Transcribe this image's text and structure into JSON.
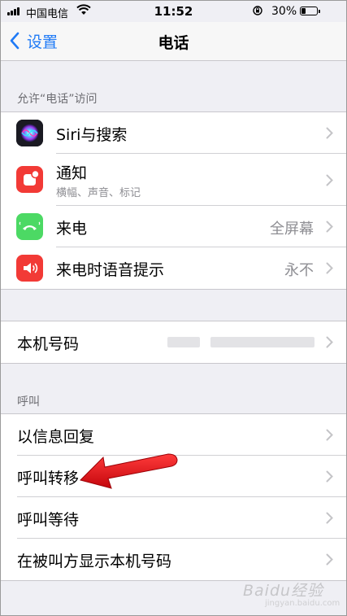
{
  "status_bar": {
    "carrier": "中国电信",
    "time": "11:52",
    "battery": "30%",
    "battery_level": 0.3
  },
  "nav": {
    "back_label": "设置",
    "title": "电话"
  },
  "section_allow": {
    "header": "允许“电话”访问",
    "rows": [
      {
        "label": "Siri与搜索",
        "icon": "siri-icon"
      },
      {
        "label": "通知",
        "sublabel": "横幅、声音、标记",
        "icon": "notifications-icon"
      },
      {
        "label": "来电",
        "value": "全屏幕",
        "icon": "phone-icon"
      },
      {
        "label": "来电时语音提示",
        "value": "永不",
        "icon": "speaker-icon"
      }
    ]
  },
  "my_number": {
    "label": "本机号码"
  },
  "section_calls": {
    "header": "呼叫",
    "rows": [
      {
        "label": "以信息回复"
      },
      {
        "label": "呼叫转移"
      },
      {
        "label": "呼叫等待"
      },
      {
        "label": "在被叫方显示本机号码"
      }
    ]
  },
  "watermark": {
    "brand": "Baidu经验",
    "url": "jingyan.baidu.com"
  },
  "colors": {
    "accent": "#1f7af6",
    "annotation_arrow": "#e8141b"
  }
}
